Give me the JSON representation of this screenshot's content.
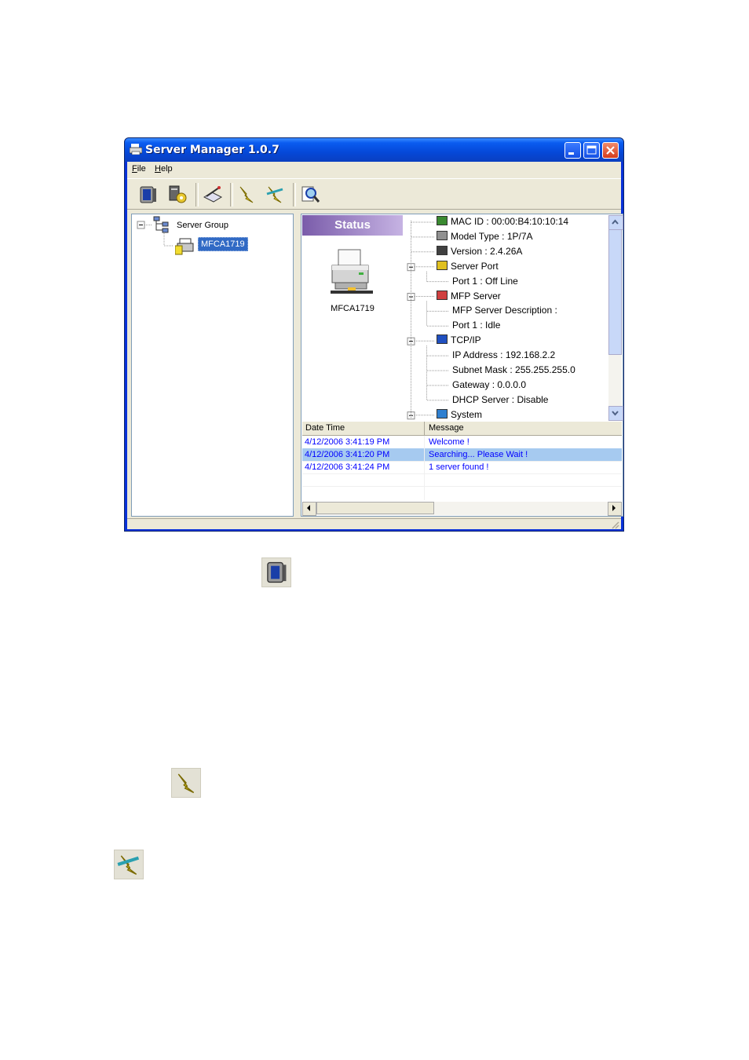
{
  "window": {
    "title": "Server Manager 1.0.7",
    "menu": [
      {
        "label": "File",
        "accel": "F",
        "rest": "ile"
      },
      {
        "label": "Help",
        "accel": "H",
        "rest": "elp"
      }
    ],
    "toolbar_icons": [
      "monitor-icon",
      "server-settings-icon",
      "printer-wizard-icon",
      "connect-icon",
      "disconnect-icon",
      "search-icon"
    ]
  },
  "server_tree": {
    "group_label": "Server Group",
    "device_label": "MFCA1719"
  },
  "status_panel": {
    "banner": "Status",
    "device_name": "MFCA1719"
  },
  "info_tree": [
    {
      "text": "MAC ID : 00:00:B4:10:10:14",
      "icon": "network-card-icon"
    },
    {
      "text": "Model Type : 1P/7A",
      "icon": "model-icon"
    },
    {
      "text": "Version : 2.4.26A",
      "icon": "version-icon"
    },
    {
      "text": "Server Port",
      "icon": "port-icon"
    },
    {
      "text": "Port 1 : Off Line",
      "icon": ""
    },
    {
      "text": "MFP Server",
      "icon": "mfp-icon"
    },
    {
      "text": "MFP Server Description :",
      "icon": ""
    },
    {
      "text": "Port 1 : Idle",
      "icon": ""
    },
    {
      "text": "TCP/IP",
      "icon": "tcpip-icon"
    },
    {
      "text": "IP Address : 192.168.2.2",
      "icon": ""
    },
    {
      "text": "Subnet Mask : 255.255.255.0",
      "icon": ""
    },
    {
      "text": "Gateway : 0.0.0.0",
      "icon": ""
    },
    {
      "text": "DHCP Server : Disable",
      "icon": ""
    },
    {
      "text": "System",
      "icon": "system-icon"
    }
  ],
  "log": {
    "columns": [
      "Date Time",
      "Message"
    ],
    "rows": [
      {
        "time": "4/12/2006 3:41:19 PM",
        "message": "Welcome !"
      },
      {
        "time": "4/12/2006 3:41:20 PM",
        "message": "Searching... Please Wait !"
      },
      {
        "time": "4/12/2006 3:41:24 PM",
        "message": "1 server found !"
      }
    ]
  },
  "standalone_icons": [
    "monitor-icon",
    "connect-icon",
    "disconnect-icon"
  ]
}
